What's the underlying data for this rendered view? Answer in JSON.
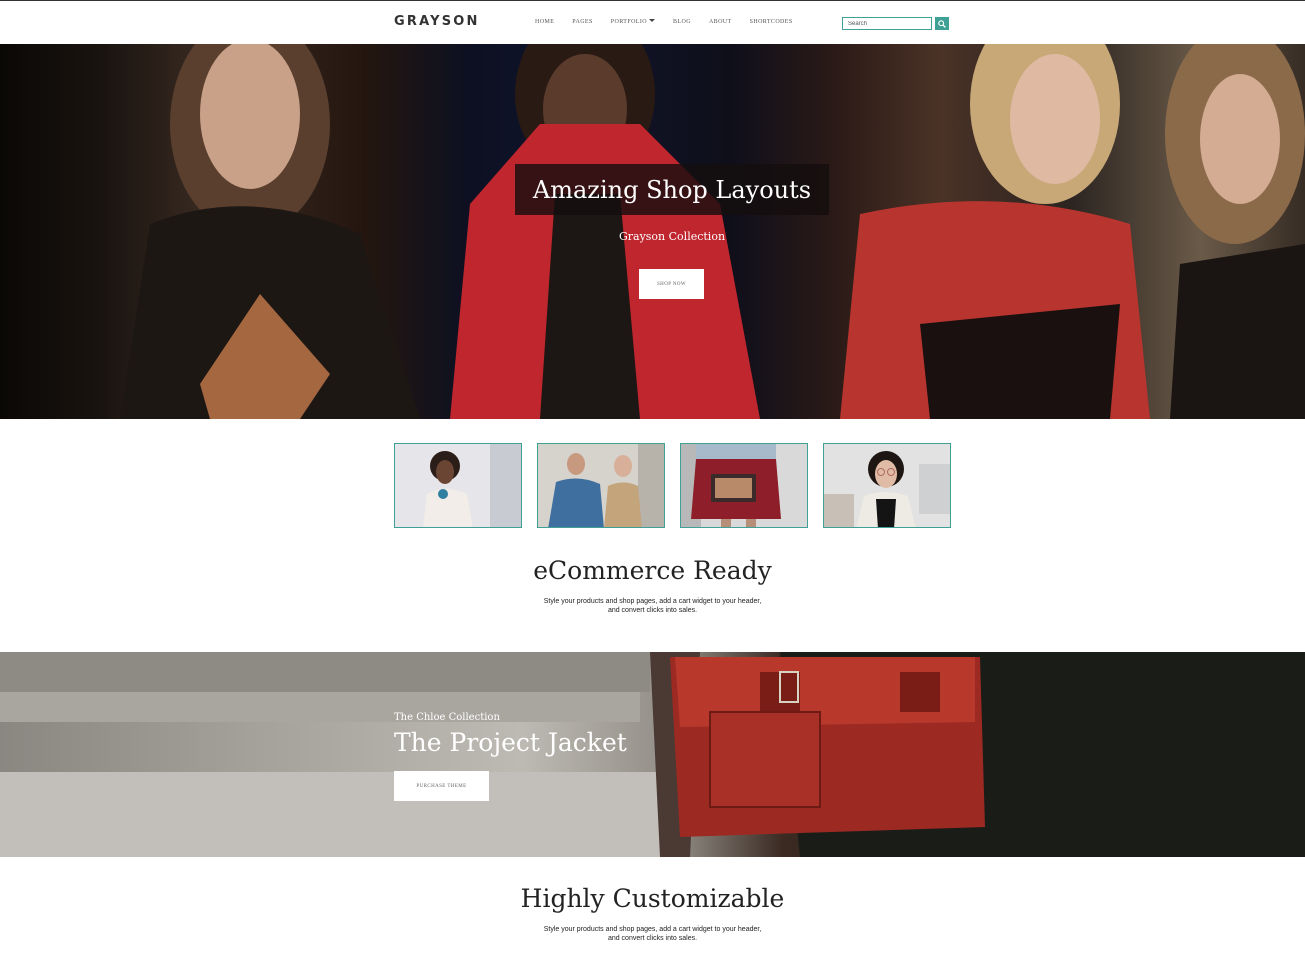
{
  "header": {
    "logo": "GRAYSON",
    "nav": [
      {
        "label": "HOME"
      },
      {
        "label": "PAGES"
      },
      {
        "label": "PORTFOLIO",
        "has_dropdown": true
      },
      {
        "label": "BLOG"
      },
      {
        "label": "ABOUT"
      },
      {
        "label": "SHORTCODES"
      }
    ],
    "search_placeholder": "Search",
    "search_icon": "search-icon"
  },
  "hero": {
    "title": "Amazing Shop Layouts",
    "subtitle": "Grayson Collection",
    "button_label": "SHOP NOW"
  },
  "thumbnails": [
    {
      "name": "thumb-woman-white-blazer"
    },
    {
      "name": "thumb-two-men-denim"
    },
    {
      "name": "thumb-red-skirt-clutch"
    },
    {
      "name": "thumb-woman-glasses"
    }
  ],
  "ecommerce": {
    "title": "eCommerce Ready",
    "desc_line1": "Style your products and shop pages, add a cart widget to your header,",
    "desc_line2": "and convert clicks into sales."
  },
  "banner": {
    "eyebrow": "The Chloe Collection",
    "title": "The Project Jacket",
    "button_label": "PURCHASE THEME"
  },
  "customizable": {
    "title": "Highly Customizable",
    "desc_line1": "Style your products and shop pages, add a cart widget to your header,",
    "desc_line2": "and convert clicks into sales."
  },
  "colors": {
    "accent": "#3fa196",
    "dark_box": "#140e0e"
  }
}
